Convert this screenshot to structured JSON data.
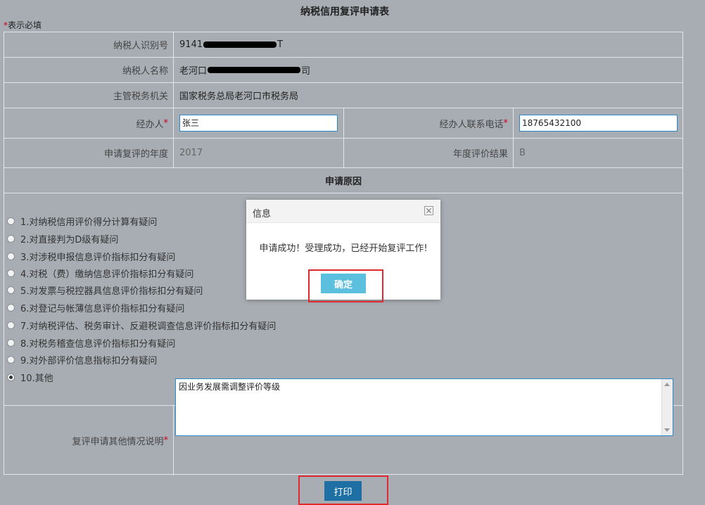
{
  "page": {
    "title": "纳税信用复评申请表",
    "required_star": "*",
    "required_note": "表示必填"
  },
  "form": {
    "taxpayer_id_label": "纳税人识别号",
    "taxpayer_id_value_prefix": "9141",
    "taxpayer_id_value_suffix": "T",
    "taxpayer_name_label": "纳税人名称",
    "taxpayer_name_value_prefix": "老河口",
    "taxpayer_name_value_suffix": "司",
    "tax_office_label": "主管税务机关",
    "tax_office_value": "国家税务总局老河口市税务局",
    "handler_label": "经办人",
    "handler_value": "张三",
    "handler_phone_label": "经办人联系电话",
    "handler_phone_value": "18765432100",
    "year_label": "申请复评的年度",
    "year_value": "2017",
    "result_label": "年度评价结果",
    "result_value": "B",
    "reason_section_title": "申请原因",
    "reasons": [
      {
        "label": "1.对纳税信用评价得分计算有疑问",
        "selected": false
      },
      {
        "label": "2.对直接判为D级有疑问",
        "selected": false
      },
      {
        "label": "3.对涉税申报信息评价指标扣分有疑问",
        "selected": false
      },
      {
        "label": "4.对税（费）缴纳信息评价指标扣分有疑问",
        "selected": false
      },
      {
        "label": "5.对发票与税控器具信息评价指标扣分有疑问",
        "selected": false
      },
      {
        "label": "6.对登记与帐薄信息评价指标扣分有疑问",
        "selected": false
      },
      {
        "label": "7.对纳税评估、税务审计、反避税调查信息评价指标扣分有疑问",
        "selected": false
      },
      {
        "label": "8.对税务稽查信息评价指标扣分有疑问",
        "selected": false
      },
      {
        "label": "9.对外部评价信息指标扣分有疑问",
        "selected": false
      },
      {
        "label": "10.其他",
        "selected": true
      }
    ],
    "other_desc_label": "复评申请其他情况说明",
    "other_desc_value": "因业务发展需调整评价等级"
  },
  "actions": {
    "print_label": "打印"
  },
  "dialog": {
    "title": "信息",
    "message": "申请成功！受理成功，已经开始复评工作!",
    "ok_label": "确定"
  },
  "colors": {
    "highlight": "#e0292e",
    "ok_button": "#5bc0de",
    "print_button": "#1e6fa3"
  }
}
